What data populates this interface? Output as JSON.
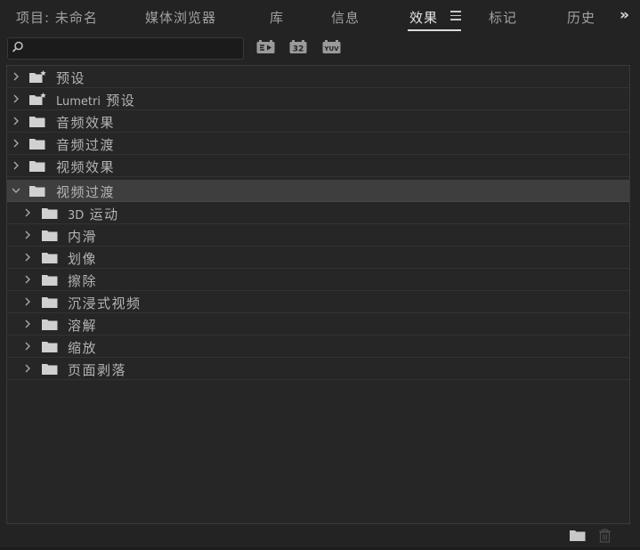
{
  "tabs": [
    {
      "label": "项目: 未命名",
      "active": false
    },
    {
      "label": "媒体浏览器",
      "active": false
    },
    {
      "label": "库",
      "active": false
    },
    {
      "label": "信息",
      "active": false
    },
    {
      "label": "效果",
      "active": true
    },
    {
      "label": "标记",
      "active": false
    },
    {
      "label": "历史",
      "active": false
    }
  ],
  "overflow_label": "»",
  "search": {
    "value": "",
    "placeholder": ""
  },
  "toolbar": {
    "accelerated_label": "GPU",
    "bit32_label": "32",
    "yuv_label": "YUV"
  },
  "tree": {
    "items": [
      {
        "label": "预设",
        "expanded": false,
        "level": 0,
        "icon": "preset-folder-icon"
      },
      {
        "label_latin": "Lumetri",
        "label": "预设",
        "expanded": false,
        "level": 0,
        "icon": "preset-folder-icon"
      },
      {
        "label": "音频效果",
        "expanded": false,
        "level": 0,
        "icon": "folder-icon"
      },
      {
        "label": "音频过渡",
        "expanded": false,
        "level": 0,
        "icon": "folder-icon"
      },
      {
        "label": "视频效果",
        "expanded": false,
        "level": 0,
        "icon": "folder-icon"
      },
      {
        "label": "视频过渡",
        "expanded": true,
        "level": 0,
        "icon": "folder-icon",
        "selected": true
      },
      {
        "label_latin": "3D",
        "label": "运动",
        "expanded": false,
        "level": 1,
        "icon": "folder-icon"
      },
      {
        "label": "内滑",
        "expanded": false,
        "level": 1,
        "icon": "folder-icon"
      },
      {
        "label": "划像",
        "expanded": false,
        "level": 1,
        "icon": "folder-icon"
      },
      {
        "label": "擦除",
        "expanded": false,
        "level": 1,
        "icon": "folder-icon"
      },
      {
        "label": "沉浸式视频",
        "expanded": false,
        "level": 1,
        "icon": "folder-icon"
      },
      {
        "label": "溶解",
        "expanded": false,
        "level": 1,
        "icon": "folder-icon"
      },
      {
        "label": "缩放",
        "expanded": false,
        "level": 1,
        "icon": "folder-icon"
      },
      {
        "label": "页面剥落",
        "expanded": false,
        "level": 1,
        "icon": "folder-icon"
      }
    ]
  },
  "colors": {
    "background": "#232323",
    "panel": "#262626",
    "selected_row": "#3e3e3e",
    "text": "#b4b4b4",
    "active_tab": "#e6e6e6"
  }
}
